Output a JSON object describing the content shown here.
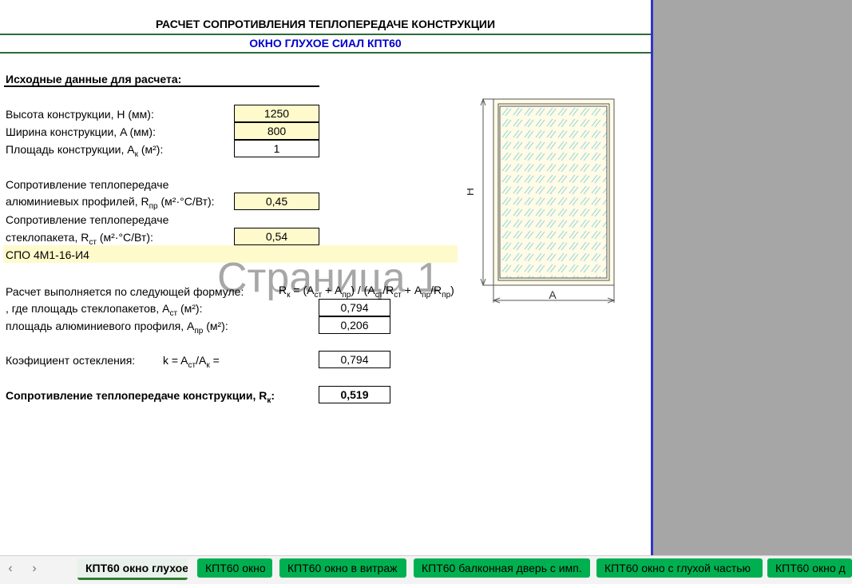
{
  "header": {
    "title": "РАСЧЕТ СОПРОТИВЛЕНИЯ ТЕПЛОПЕРЕДАЧЕ КОНСТРУКЦИИ",
    "subtitle": "ОКНО ГЛУХОЕ СИАЛ КПТ60",
    "subtitle_color": "#0000cc"
  },
  "inputs": {
    "section_title": "Исходные данные для расчета:",
    "height_label": "Высота конструкции, H (мм):",
    "height_value": "1250",
    "width_label": "Ширина конструкции, A (мм):",
    "width_value": "800",
    "area_label_main": "Площадь конструкции, A",
    "area_label_sub": "к",
    "area_label_end": " (м²):",
    "area_value": "1",
    "rpr_line1": "Сопротивление теплопередаче",
    "rpr_label_main": "алюминиевых профилей, R",
    "rpr_label_sub": "пр",
    "rpr_label_end": " (м²·°C/Вт):",
    "rpr_value": "0,45",
    "rst_line1": "Сопротивление теплопередаче",
    "rst_label_main": "стеклопакета, R",
    "rst_label_sub": "ст",
    "rst_label_end": " (м²·°C/Вт):",
    "rst_value": "0,54",
    "glass_spec": "СПО 4М1-16-И4"
  },
  "calc": {
    "formula_label": "Расчет выполняется по следующей формуле:",
    "f_r": "R",
    "f_k": "к",
    "f_1": " = (A",
    "f_st": "ст",
    "f_2": " + A",
    "f_pr": "пр",
    "f_3": ") / (A",
    "f_4": "/R",
    "f_5": " + A",
    "f_6": "/R",
    "f_7": ")",
    "ast_label_main": ", где площадь стеклопакетов, A",
    "ast_label_sub": "ст",
    "ast_label_end": " (м²):",
    "ast_value": "0,794",
    "apr_label_main": "площадь алюминиевого профиля, A",
    "apr_label_sub": "пр",
    "apr_label_end": " (м²):",
    "apr_value": "0,206",
    "k_label": "Коэфициент остекления:",
    "k_formula_main": "k = A",
    "k_formula_sub1": "ст",
    "k_formula_mid": "/A",
    "k_formula_sub2": "к",
    "k_formula_end": " =",
    "k_value": "0,794",
    "result_label_main": "Сопротивление теплопередаче конструкции, R",
    "result_label_sub": "к",
    "result_label_end": ":",
    "result_value": "0,519"
  },
  "drawing": {
    "h_label": "H",
    "a_label": "A"
  },
  "watermark": "Страница 1",
  "sheet_tabs": {
    "prev_icon": "‹",
    "next_icon": "›",
    "tabs": [
      "КПТ60 окно глухое",
      "КПТ60 окно",
      "КПТ60 окно в витраж",
      "КПТ60 балконная дверь с имп.",
      "КПТ60 окно с глухой частью",
      "КПТ60 окно д"
    ],
    "active_index": 0
  }
}
